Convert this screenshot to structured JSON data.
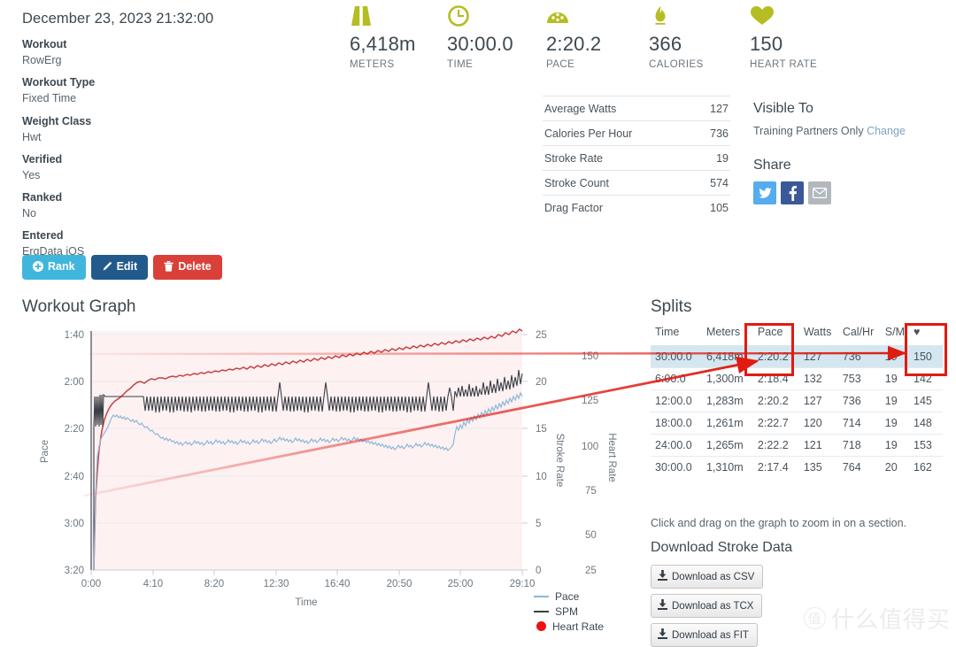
{
  "summary": {
    "date": "December 23, 2023 21:32:00",
    "meta": [
      {
        "label": "Workout",
        "value": "RowErg"
      },
      {
        "label": "Workout Type",
        "value": "Fixed Time"
      },
      {
        "label": "Weight Class",
        "value": "Hwt"
      },
      {
        "label": "Verified",
        "value": "Yes"
      },
      {
        "label": "Ranked",
        "value": "No"
      },
      {
        "label": "Entered",
        "value": "ErgData iOS"
      }
    ],
    "buttons": {
      "rank": "Rank",
      "edit": "Edit",
      "delete": "Delete"
    }
  },
  "stats": [
    {
      "icon": "road-icon",
      "value": "6,418m",
      "label": "METERS"
    },
    {
      "icon": "clock-icon",
      "value": "30:00.0",
      "label": "TIME"
    },
    {
      "icon": "speedometer-icon",
      "value": "2:20.2",
      "label": "PACE"
    },
    {
      "icon": "flame-icon",
      "value": "366",
      "label": "CALORIES"
    },
    {
      "icon": "heart-icon",
      "value": "150",
      "label": "HEART RATE"
    }
  ],
  "details": [
    {
      "label": "Average Watts",
      "value": "127"
    },
    {
      "label": "Calories Per Hour",
      "value": "736"
    },
    {
      "label": "Stroke Rate",
      "value": "19"
    },
    {
      "label": "Stroke Count",
      "value": "574"
    },
    {
      "label": "Drag Factor",
      "value": "105"
    }
  ],
  "visible": {
    "heading": "Visible To",
    "value": "Training Partners Only",
    "change_link": "Change"
  },
  "share": {
    "heading": "Share",
    "icons": [
      "twitter-icon",
      "facebook-icon",
      "email-icon"
    ]
  },
  "graph": {
    "title": "Workout Graph"
  },
  "splits": {
    "title": "Splits",
    "columns": [
      "Time",
      "Meters",
      "Pace",
      "Watts",
      "Cal/Hr",
      "S/M",
      "♥"
    ],
    "rows": [
      {
        "time": "30:00.0",
        "meters": "6,418m",
        "pace": "2:20.2",
        "watts": "127",
        "calhr": "736",
        "sm": "19",
        "hr": "150",
        "highlight": true
      },
      {
        "time": "6:00.0",
        "meters": "1,300m",
        "pace": "2:18.4",
        "watts": "132",
        "calhr": "753",
        "sm": "19",
        "hr": "142",
        "highlight": false
      },
      {
        "time": "12:00.0",
        "meters": "1,283m",
        "pace": "2:20.2",
        "watts": "127",
        "calhr": "736",
        "sm": "19",
        "hr": "145",
        "highlight": false
      },
      {
        "time": "18:00.0",
        "meters": "1,261m",
        "pace": "2:22.7",
        "watts": "120",
        "calhr": "714",
        "sm": "19",
        "hr": "148",
        "highlight": false
      },
      {
        "time": "24:00.0",
        "meters": "1,265m",
        "pace": "2:22.2",
        "watts": "121",
        "calhr": "718",
        "sm": "19",
        "hr": "153",
        "highlight": false
      },
      {
        "time": "30:00.0",
        "meters": "1,310m",
        "pace": "2:17.4",
        "watts": "135",
        "calhr": "764",
        "sm": "20",
        "hr": "162",
        "highlight": false
      }
    ]
  },
  "zoom_hint": "Click and drag on the graph to zoom in on a section.",
  "download": {
    "heading": "Download Stroke Data",
    "buttons": [
      "Download as CSV",
      "Download as TCX",
      "Download as FIT"
    ]
  },
  "watermark": {
    "mark": "值",
    "text": "什么值得买"
  },
  "colors": {
    "accent_green": "#b5bd23",
    "pace_line": "#8fb8d8",
    "spm_line": "#3a3f45",
    "hr_line": "#c6403f",
    "hr_fill": "#fdf0f1",
    "annotation_red": "#e01b12",
    "highlight_row": "#d4e7f0",
    "btn_rank": "#41b6dd",
    "btn_edit": "#235a8c",
    "btn_delete": "#d9403a",
    "twitter": "#55acee",
    "facebook": "#3b5998",
    "email": "#b3b8bd"
  },
  "chart_data": {
    "type": "line",
    "title": "Workout Graph",
    "xlabel": "Time",
    "grid": true,
    "legend_position": "bottom-right",
    "x_ticks": [
      "0:00",
      "4:10",
      "8:20",
      "12:30",
      "16:40",
      "20:50",
      "25:00",
      "29:10"
    ],
    "axes": [
      {
        "name": "Pace",
        "side": "left",
        "ticks": [
          "1:40",
          "2:00",
          "2:20",
          "2:40",
          "3:00",
          "3:20"
        ],
        "inverted": true
      },
      {
        "name": "Stroke Rate",
        "side": "right",
        "ticks": [
          "25",
          "20",
          "15",
          "10",
          "5",
          "0"
        ],
        "range": [
          0,
          27
        ]
      },
      {
        "name": "Heart Rate",
        "side": "right",
        "ticks": [
          "150",
          "125",
          "100",
          "75",
          "50",
          "25"
        ],
        "range": [
          15,
          160
        ]
      }
    ],
    "series": [
      {
        "name": "Pace",
        "color": "#8fb8d8",
        "axis": "Pace",
        "unit": "min/500m",
        "values_pace_seconds": [
          200,
          148,
          143,
          140,
          139,
          138,
          137,
          137,
          138,
          138,
          139,
          139,
          140,
          140,
          140,
          141,
          141,
          142,
          141,
          141,
          142,
          142,
          142,
          143,
          143,
          143,
          142,
          142,
          143,
          143,
          143,
          143,
          143,
          143,
          142,
          142,
          143,
          143,
          143,
          142,
          142,
          142,
          142,
          142,
          143,
          143,
          142,
          142,
          142,
          141,
          141,
          141,
          140,
          139,
          138,
          137,
          137,
          137,
          137
        ]
      },
      {
        "name": "SPM",
        "color": "#3a3f45",
        "axis": "Stroke Rate",
        "unit": "strokes/min",
        "values_spm": [
          19,
          19,
          20,
          19,
          19,
          19,
          19,
          19,
          19,
          19,
          19,
          19,
          19,
          19,
          19,
          19,
          18,
          19,
          18,
          19,
          18,
          19,
          18,
          19,
          19,
          18,
          19,
          18,
          19,
          19,
          18,
          19,
          19,
          19,
          18,
          19,
          19,
          19,
          19,
          19,
          19,
          19,
          19,
          20,
          19,
          20,
          19,
          20,
          20,
          20,
          20,
          20,
          20,
          20,
          21,
          20,
          21,
          21,
          20
        ]
      },
      {
        "name": "Heart Rate",
        "color": "#c6403f",
        "axis": "Heart Rate",
        "unit": "bpm",
        "values_bpm": [
          88,
          104,
          113,
          119,
          123,
          126,
          128,
          130,
          131,
          132,
          133,
          134,
          135,
          136,
          137,
          137,
          138,
          138,
          139,
          139,
          140,
          140,
          141,
          141,
          142,
          143,
          143,
          144,
          145,
          145,
          146,
          146,
          147,
          147,
          148,
          148,
          149,
          149,
          150,
          150,
          151,
          151,
          152,
          152,
          153,
          153,
          154,
          154,
          155,
          155,
          156,
          157,
          157,
          158,
          158,
          159,
          160,
          161,
          162
        ]
      }
    ],
    "annotations": [
      {
        "type": "box",
        "target": "pace-column"
      },
      {
        "type": "box",
        "target": "heart-rate-column"
      },
      {
        "type": "arrow",
        "from": "chart-heart-rate-line",
        "to": "splits-heart-rate-cell"
      },
      {
        "type": "arrow",
        "from": "chart-pace-line",
        "to": "splits-pace-cell"
      }
    ]
  }
}
